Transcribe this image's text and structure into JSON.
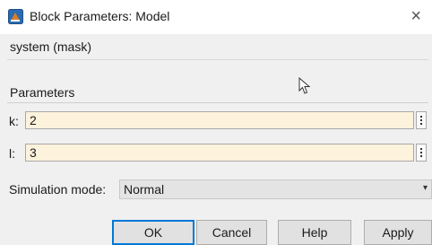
{
  "window": {
    "title": "Block Parameters: Model",
    "close_glyph": "×"
  },
  "mask_label": "system (mask)",
  "parameters": {
    "title": "Parameters",
    "fields": [
      {
        "label": "k:",
        "value": "2"
      },
      {
        "label": "l:",
        "value": "3"
      }
    ]
  },
  "simulation_mode": {
    "label": "Simulation mode:",
    "selected": "Normal"
  },
  "buttons": {
    "ok": "OK",
    "cancel": "Cancel",
    "help": "Help",
    "apply": "Apply"
  },
  "colors": {
    "input_bg": "#fdf2dc",
    "default_button_border": "#0078d7",
    "panel_bg": "#f0f0f0"
  },
  "icons": {
    "app": "simulink-app-icon",
    "close": "close-icon",
    "kebab": "vertical-ellipsis-icon",
    "dropdown": "chevron-down-icon",
    "cursor": "mouse-pointer-icon"
  }
}
